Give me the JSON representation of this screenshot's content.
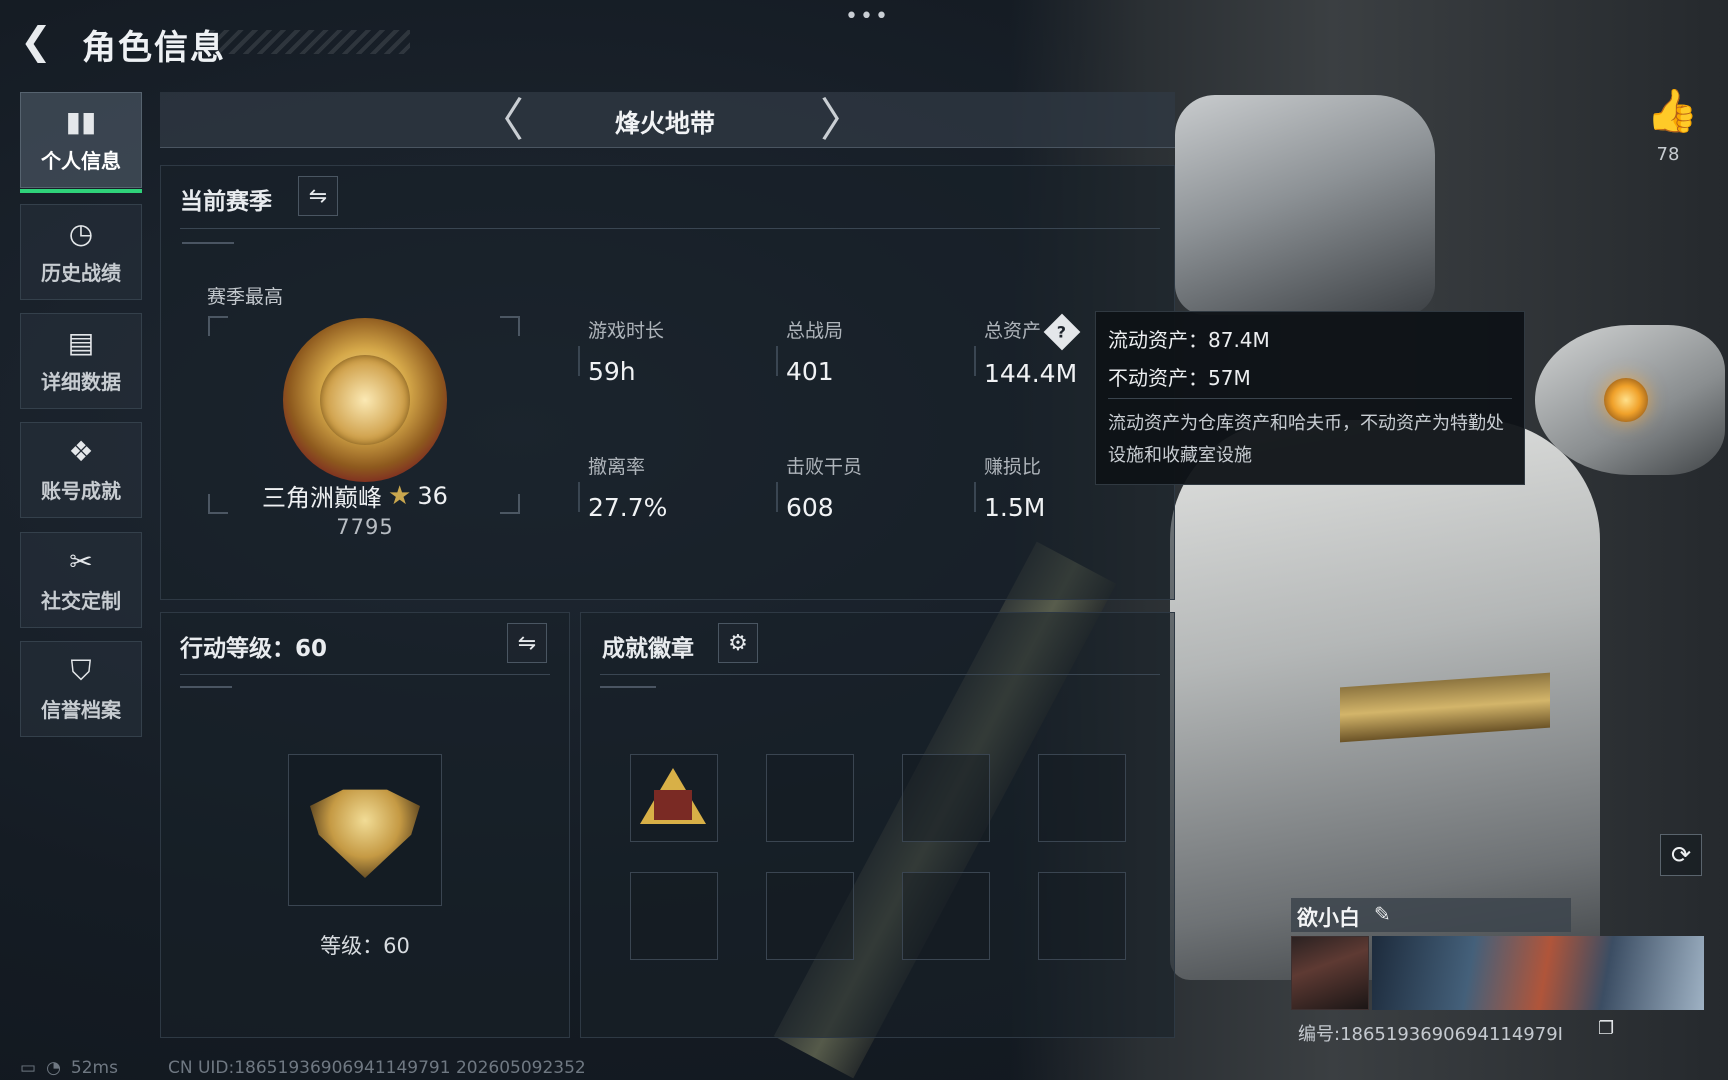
{
  "header": {
    "title": "角色信息",
    "more": "•••"
  },
  "sidebar": {
    "items": [
      {
        "label": "个人信息",
        "icon": "bar-chart-icon",
        "glyph": "▮▮"
      },
      {
        "label": "历史战绩",
        "icon": "history-icon",
        "glyph": "◷"
      },
      {
        "label": "详细数据",
        "icon": "folder-icon",
        "glyph": "▤"
      },
      {
        "label": "账号成就",
        "icon": "medal-icon",
        "glyph": "❖"
      },
      {
        "label": "社交定制",
        "icon": "tools-icon",
        "glyph": "✂"
      },
      {
        "label": "信誉档案",
        "icon": "shield-icon",
        "glyph": "⛉"
      }
    ],
    "active_index": 0
  },
  "mode": {
    "prev": "〈",
    "title": "烽火地带",
    "next": "〉"
  },
  "season": {
    "title": "当前赛季",
    "best_label": "赛季最高",
    "rank_name": "三角洲巅峰",
    "rank_star": "★",
    "rank_stars": "36",
    "rank_points": "7795",
    "stats": [
      {
        "label": "游戏时长",
        "value": "59h"
      },
      {
        "label": "总战局",
        "value": "401"
      },
      {
        "label": "总资产",
        "value": "144.4M"
      },
      {
        "label": "撤离率",
        "value": "27.7%"
      },
      {
        "label": "击败干员",
        "value": "608"
      },
      {
        "label": "赚损比",
        "value": "1.5M"
      }
    ],
    "help": "?"
  },
  "tooltip": {
    "liquid": "流动资产：87.4M",
    "fixed": "不动资产：57M",
    "description": "流动资产为仓库资产和哈夫币，不动资产为特勤处设施和收藏室设施"
  },
  "action_level": {
    "title": "行动等级：60",
    "level_text": "等级：60"
  },
  "badges": {
    "title": "成就徽章"
  },
  "profile": {
    "name": "欲小白",
    "id_text": "编号:1865193690694114979I",
    "likes": "78"
  },
  "footer": {
    "ping": "52ms",
    "uid": "CN UID:18651936906941149791 202605092352"
  },
  "colors": {
    "accent_green": "#2fd27a",
    "gold": "#d8b047"
  }
}
